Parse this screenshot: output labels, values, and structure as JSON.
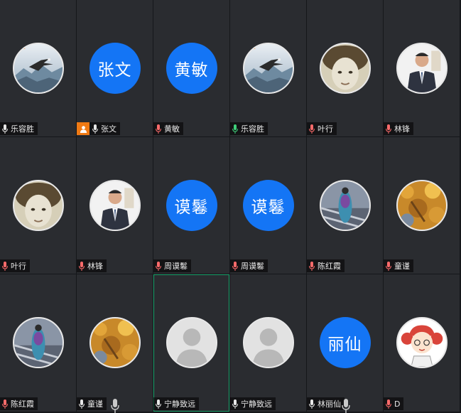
{
  "colors": {
    "accent": "#1475f5",
    "host_badge": "#f07a14",
    "active_border": "#19a36b",
    "mic_muted": "#ff6b6b",
    "mic_active": "#3fd07a",
    "tile_bg": "#2a2c30"
  },
  "participants": [
    {
      "name": "乐容胜",
      "avatar_type": "photo",
      "avatar_icon": "eagle-landscape",
      "mic": "unmuted",
      "host": false
    },
    {
      "name": "张文",
      "avatar_type": "text",
      "avatar_text": "张文",
      "mic": "unmuted",
      "host": true
    },
    {
      "name": "黄敏",
      "avatar_type": "text",
      "avatar_text": "黄敏",
      "mic": "muted",
      "host": false
    },
    {
      "name": "乐容胜",
      "avatar_type": "photo",
      "avatar_icon": "eagle-landscape",
      "mic": "speaking",
      "host": false
    },
    {
      "name": "叶行",
      "avatar_type": "photo",
      "avatar_icon": "boy-portrait-sepia",
      "mic": "muted",
      "host": false
    },
    {
      "name": "林锋",
      "avatar_type": "photo",
      "avatar_icon": "man-in-suit",
      "mic": "muted",
      "host": false
    },
    {
      "name": "叶行",
      "avatar_type": "photo",
      "avatar_icon": "boy-portrait-sepia",
      "mic": "muted",
      "host": false
    },
    {
      "name": "林锋",
      "avatar_type": "photo",
      "avatar_icon": "man-in-suit",
      "mic": "muted",
      "host": false
    },
    {
      "name": "周谟鬈",
      "avatar_type": "text",
      "avatar_text": "谟鬈",
      "mic": "muted",
      "host": false
    },
    {
      "name": "周谟鬈",
      "avatar_type": "text",
      "avatar_text": "谟鬈",
      "mic": "muted",
      "host": false
    },
    {
      "name": "陈红霞",
      "avatar_type": "photo",
      "avatar_icon": "colorful-figure",
      "mic": "muted",
      "host": false
    },
    {
      "name": "童谨",
      "avatar_type": "photo",
      "avatar_icon": "autumn-leaves",
      "mic": "muted",
      "host": false
    },
    {
      "name": "陈红霞",
      "avatar_type": "photo",
      "avatar_icon": "colorful-figure",
      "mic": "muted",
      "host": false
    },
    {
      "name": "童谨",
      "avatar_type": "photo",
      "avatar_icon": "autumn-leaves",
      "mic": "unmuted",
      "host": false
    },
    {
      "name": "宁静致远",
      "avatar_type": "default",
      "avatar_icon": "default-person",
      "mic": "unmuted",
      "host": false,
      "active": true
    },
    {
      "name": "宁静致远",
      "avatar_type": "default",
      "avatar_icon": "default-person",
      "mic": "unmuted",
      "host": false
    },
    {
      "name": "林丽仙",
      "avatar_type": "text",
      "avatar_text": "丽仙",
      "mic": "unmuted",
      "host": false
    },
    {
      "name": "D",
      "avatar_type": "photo",
      "avatar_icon": "cartoon-girl",
      "mic": "muted",
      "host": false
    }
  ]
}
